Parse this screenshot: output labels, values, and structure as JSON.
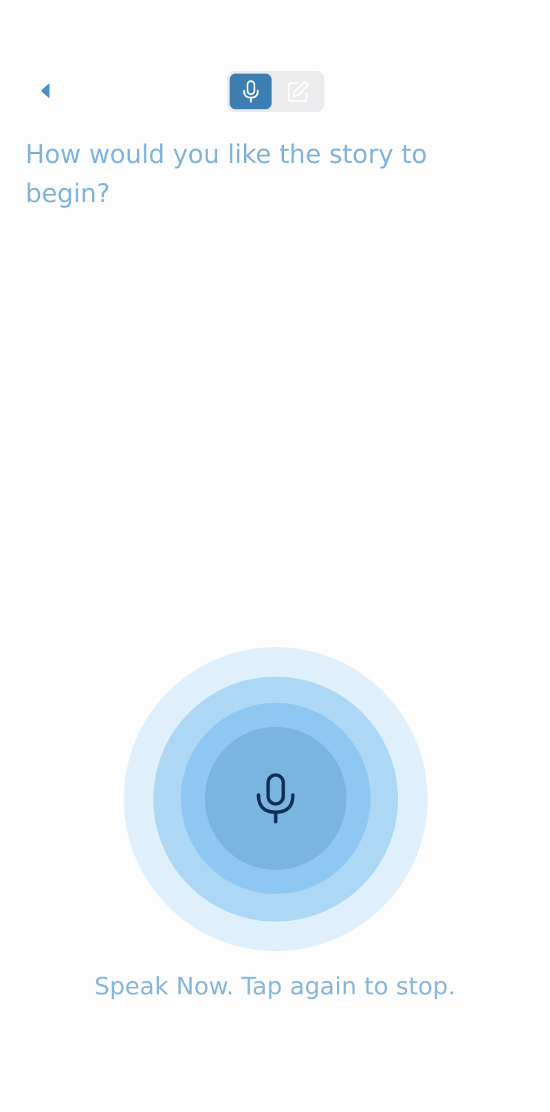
{
  "header": {
    "back_icon": "chevron-left-icon",
    "modes": [
      {
        "icon": "microphone-icon",
        "active": true
      },
      {
        "icon": "edit-icon",
        "active": false
      }
    ]
  },
  "prompt": {
    "title": "How would you like the story to begin?"
  },
  "recorder": {
    "icon": "microphone-icon",
    "status": "Speak Now. Tap again to stop."
  },
  "colors": {
    "accent": "#3d7fb3",
    "title_text": "#7fb3dc",
    "status_text": "#86b7dc",
    "mic_icon": "#0f2f55",
    "ring_outer": "#dff0fc",
    "ring_middle": "#acd7f5",
    "ring_inner": "#8ec8f2",
    "record_button": "#7ab4e0"
  }
}
